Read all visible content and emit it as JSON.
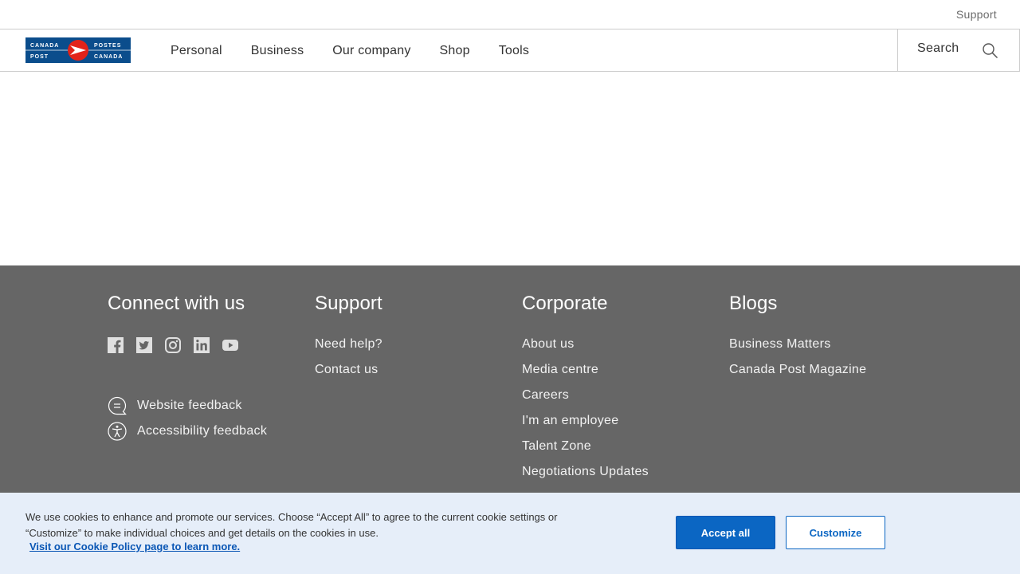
{
  "utility_bar": {
    "support_label": "Support"
  },
  "logo": {
    "line1_left": "CANADA",
    "line1_right": "POSTES",
    "line2_left": "POST",
    "line2_right": "CANADA"
  },
  "nav": {
    "items": [
      "Personal",
      "Business",
      "Our company",
      "Shop",
      "Tools"
    ],
    "search_label": "Search",
    "search_icon": "search-icon"
  },
  "footer": {
    "connect": {
      "title": "Connect with us",
      "social_icons": [
        "facebook-icon",
        "twitter-icon",
        "instagram-icon",
        "linkedin-icon",
        "youtube-icon"
      ],
      "website_feedback": "Website feedback",
      "accessibility_feedback": "Accessibility feedback"
    },
    "support": {
      "title": "Support",
      "links": [
        "Need help?",
        "Contact us"
      ]
    },
    "corporate": {
      "title": "Corporate",
      "links": [
        "About us",
        "Media centre",
        "Careers",
        "I'm an employee",
        "Talent Zone",
        "Negotiations Updates"
      ]
    },
    "blogs": {
      "title": "Blogs",
      "links": [
        "Business Matters",
        "Canada Post Magazine"
      ]
    }
  },
  "cookie_banner": {
    "text": "We use cookies to enhance and promote our services. Choose “Accept All” to agree to the current cookie settings or “Customize” to make individual choices and get details on the cookies in use.",
    "policy_link": "Visit our Cookie Policy page to learn more.",
    "accept_label": "Accept all",
    "customize_label": "Customize"
  },
  "colors": {
    "brand_blue": "#0b4d8c",
    "brand_red": "#e2231a",
    "footer_bg": "#666666",
    "cookie_bg": "#e6eef9",
    "button_blue": "#0b66c3"
  }
}
